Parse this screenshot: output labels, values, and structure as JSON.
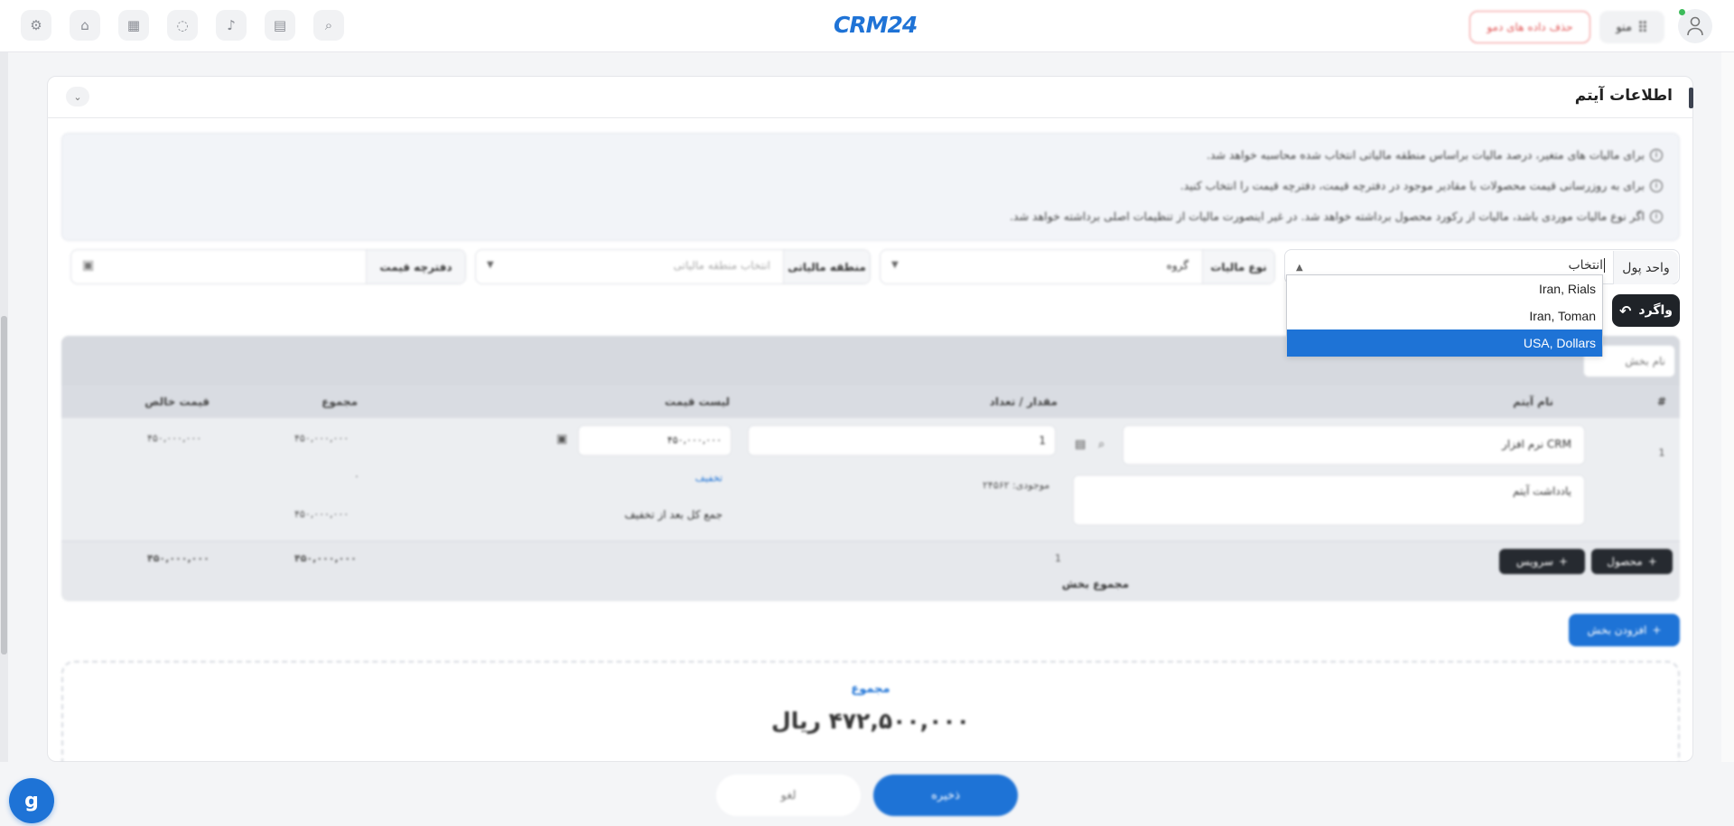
{
  "header": {
    "logo_text": "CRM24",
    "demo_button": "حذف داده های دمو",
    "menu_label": "منو",
    "icons": [
      "search-icon",
      "clipboard-icon",
      "bell-icon",
      "chat-icon",
      "calendar-icon",
      "home-icon",
      "settings-icon"
    ]
  },
  "card": {
    "title": "اطلاعات آیتم",
    "info_lines": [
      "برای مالیات های متغیر، درصد مالیات براساس منطقه مالیاتی انتخاب شده محاسبه خواهد شد.",
      "برای به روزرسانی قیمت محصولات با مقادیر موجود در دفترچه قیمت، دفترچه قیمت را انتخاب کنید.",
      "اگر نوع مالیات موردی باشد، مالیات از رکورد محصول برداشته خواهد شد. در غیر اینصورت مالیات از تنظیمات اصلی برداشته خواهد شد."
    ]
  },
  "filters": {
    "currency_label": "واحد پول",
    "currency_value": "انتخاب",
    "currency_options": [
      "Iran, Rials",
      "Iran, Toman",
      "USA, Dollars"
    ],
    "currency_highlighted": "USA, Dollars",
    "tax_type_label": "نوع مالیات",
    "tax_type_value": "گروه",
    "tax_region_label": "منطقه مالیاتی",
    "tax_region_placeholder": "انتخاب منطقه مالیاتی",
    "price_book_label": "دفترچه قیمت"
  },
  "undo_button": "واگرد",
  "table": {
    "section_name_placeholder": "نام بخش",
    "columns": {
      "index": "#",
      "item_name": "نام آیتم",
      "quantity": "مقدار / تعداد",
      "list_price": "لیست قیمت",
      "total": "مجموع",
      "net_price": "قیمت خالص"
    },
    "row": {
      "number": "1",
      "item_name": "نرم افزار CRM",
      "item_note": "یادداشت آیتم",
      "quantity": "1",
      "stock": "موجودی: ۲۴۵۶۲",
      "list_price": "۴۵۰,۰۰۰,۰۰۰",
      "discount_link": "تخفیف",
      "after_discount_label": "جمع کل بعد از تخفیف",
      "total": "۴۵۰,۰۰۰,۰۰۰",
      "discount_value": "۰",
      "after_discount_total": "۴۵۰,۰۰۰,۰۰۰",
      "net_price": "۴۵۰,۰۰۰,۰۰۰"
    },
    "footer": {
      "product_button": "محصول",
      "service_button": "سرویس",
      "quantity_sum": "1",
      "section_total_label": "مجموع بخش",
      "total": "۴۵۰,۰۰۰,۰۰۰",
      "net_total": "۴۵۰,۰۰۰,۰۰۰"
    }
  },
  "add_section_button": "افزودن بخش",
  "summary": {
    "label": "مجموع",
    "amount": "۴۷۲,۵۰۰,۰۰۰ ریال"
  },
  "actions": {
    "save": "ذخیره",
    "cancel": "لغو"
  },
  "colors": {
    "primary": "#1e73d6",
    "dark_button": "#1f2328",
    "demo_button": "#e25a5a"
  }
}
